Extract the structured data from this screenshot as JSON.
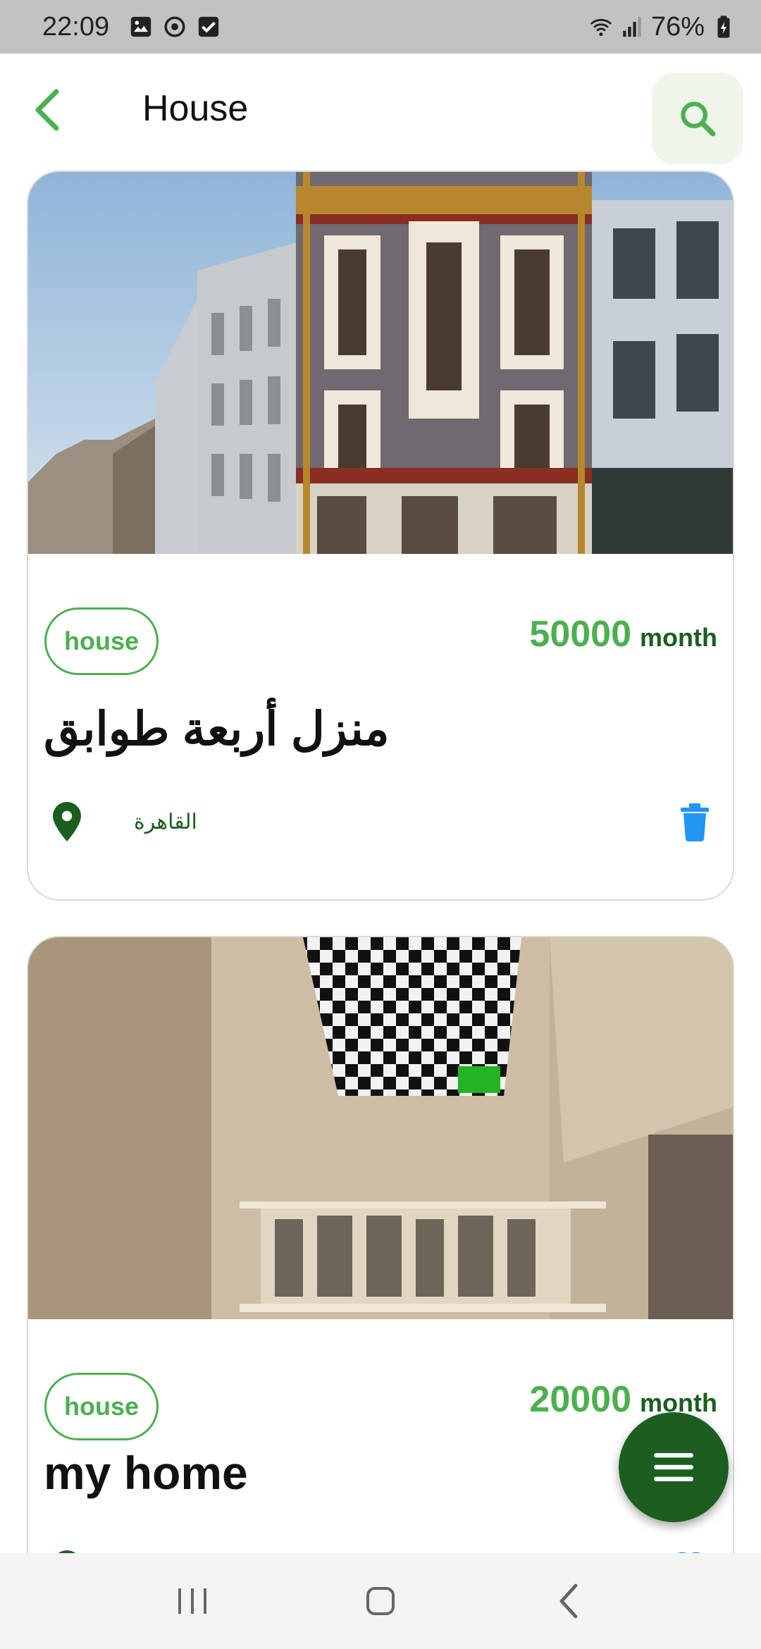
{
  "status_bar": {
    "time": "22:09",
    "battery": "76%",
    "left_icons": [
      "image-icon",
      "camera-sync-icon",
      "checkbox-icon"
    ],
    "right_icons": [
      "wifi-icon",
      "signal-icon",
      "battery-icon"
    ]
  },
  "app_bar": {
    "title": "House",
    "back_icon": "chevron-left-icon",
    "search_icon": "search-icon"
  },
  "listings": [
    {
      "tag": "house",
      "price": "50000",
      "price_unit": "month",
      "title": "منزل أربعة طوابق",
      "location": "القاهرة",
      "image": "building-facade-photo",
      "action_icon": "trash-icon"
    },
    {
      "tag": "house",
      "price": "20000",
      "price_unit": "month",
      "title": "my home",
      "location": "",
      "image": "interior-room-photo",
      "action_icon": "heart-icon"
    }
  ],
  "fab": {
    "icon": "menu-icon"
  },
  "nav_bar": {
    "icons": [
      "recents-icon",
      "home-icon",
      "back-icon"
    ]
  },
  "colors": {
    "accent_green": "#4caf50",
    "dark_green": "#1b5e20",
    "action_blue": "#2196f3",
    "status_bar_bg": "#c2c2c2"
  }
}
